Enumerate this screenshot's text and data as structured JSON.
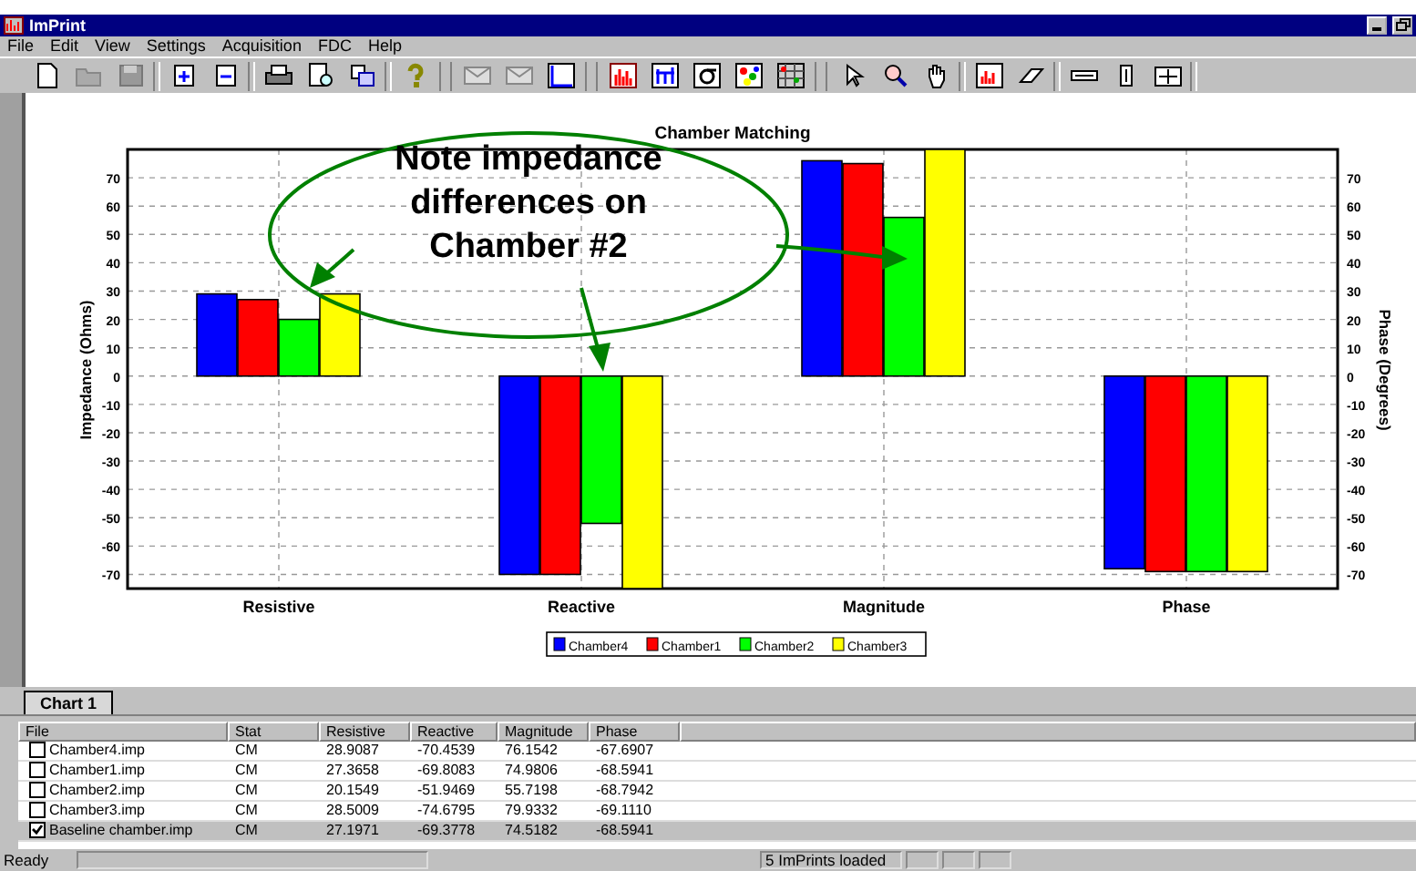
{
  "window": {
    "title": "ImPrint"
  },
  "menu": [
    "File",
    "Edit",
    "View",
    "Settings",
    "Acquisition",
    "FDC",
    "Help"
  ],
  "chart": {
    "chart_data": {
      "type": "bar",
      "title": "Chamber Matching",
      "ylabel": "Impedance (Ohms)",
      "categories": [
        "Resistive",
        "Reactive",
        "Magnitude",
        "Phase"
      ],
      "series": [
        {
          "name": "Chamber4",
          "color": "#0000ff",
          "values": [
            29,
            -70,
            76,
            -68
          ]
        },
        {
          "name": "Chamber1",
          "color": "#ff0000",
          "values": [
            27,
            -70,
            75,
            -69
          ]
        },
        {
          "name": "Chamber2",
          "color": "#00ff00",
          "values": [
            20,
            -52,
            56,
            -69
          ]
        },
        {
          "name": "Chamber3",
          "color": "#ffff00",
          "values": [
            29,
            -75,
            80,
            -69
          ]
        }
      ],
      "ylim": [
        -75,
        80
      ],
      "yticks": [
        {
          "value": 70,
          "label": "70"
        },
        {
          "value": 60,
          "label": "60"
        },
        {
          "value": 50,
          "label": "50"
        },
        {
          "value": 40,
          "label": "40"
        },
        {
          "value": 30,
          "label": "30"
        },
        {
          "value": 20,
          "label": "20"
        },
        {
          "value": 10,
          "label": "10"
        },
        {
          "value": 0,
          "label": "0"
        },
        {
          "value": -10,
          "label": "-10"
        },
        {
          "value": -20,
          "label": "-20"
        },
        {
          "value": -30,
          "label": "-30"
        },
        {
          "value": -40,
          "label": "-40"
        },
        {
          "value": -50,
          "label": "-50"
        },
        {
          "value": -60,
          "label": "-60"
        },
        {
          "value": -70,
          "label": "-70"
        }
      ],
      "grid": true,
      "legend": true
    },
    "right_axis": {
      "label": "Phase (Degrees)",
      "ticks": [
        "70",
        "60",
        "50",
        "40",
        "30",
        "20",
        "10",
        "0",
        "-10",
        "-20",
        "-30",
        "-40",
        "-50",
        "-60",
        "-70"
      ]
    },
    "note_lines": [
      "Note impedance",
      "differences on",
      "Chamber #2"
    ]
  },
  "tabs": [
    {
      "label": "Chart 1",
      "selected": true
    }
  ],
  "table": {
    "columns": [
      "File",
      "Stat",
      "Resistive",
      "Reactive",
      "Magnitude",
      "Phase"
    ],
    "rows": [
      {
        "checked": false,
        "selected": false,
        "cells": [
          "Chamber4.imp",
          "CM",
          "28.9087",
          "-70.4539",
          "76.1542",
          "-67.6907"
        ]
      },
      {
        "checked": false,
        "selected": false,
        "cells": [
          "Chamber1.imp",
          "CM",
          "27.3658",
          "-69.8083",
          "74.9806",
          "-68.5941"
        ]
      },
      {
        "checked": false,
        "selected": false,
        "cells": [
          "Chamber2.imp",
          "CM",
          "20.1549",
          "-51.9469",
          "55.7198",
          "-68.7942"
        ]
      },
      {
        "checked": false,
        "selected": false,
        "cells": [
          "Chamber3.imp",
          "CM",
          "28.5009",
          "-74.6795",
          "79.9332",
          "-69.1110"
        ]
      },
      {
        "checked": true,
        "selected": true,
        "cells": [
          "Baseline chamber.imp",
          "CM",
          "27.1971",
          "-69.3778",
          "74.5182",
          "-68.5941"
        ]
      }
    ]
  },
  "status_bar": {
    "message": "Ready",
    "count": "5 ImPrints loaded"
  }
}
